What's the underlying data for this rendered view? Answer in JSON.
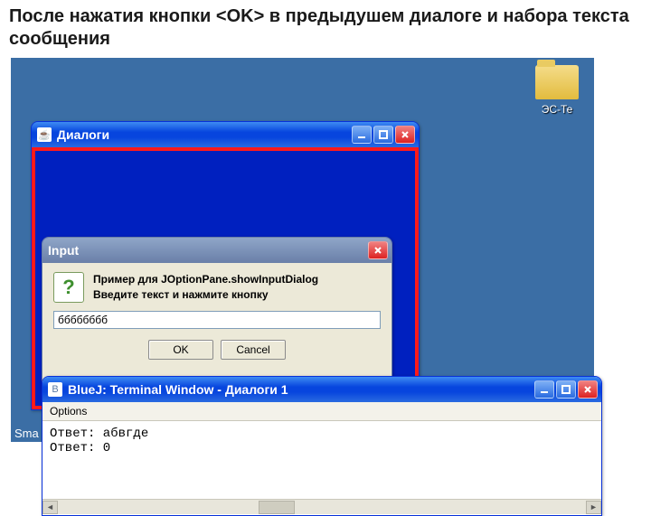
{
  "caption_pre": "После нажатия кнопки ",
  "caption_mid": "<OK>",
  "caption_post": " в предыдушем диалоге и набора текста сообщения",
  "desktop": {
    "folder_label_right": "ЭС-Те",
    "taskbar_snippet": "Sma"
  },
  "dialogs_window": {
    "title": "Диалоги"
  },
  "input_dialog": {
    "title": "Input",
    "message_line1": "Пример для JOptionPane.showInputDialog",
    "message_line2": "Введите текст и нажмите кнопку",
    "field_value": "бббббббб",
    "ok_label": "OK",
    "cancel_label": "Cancel"
  },
  "terminal": {
    "title": "BlueJ:  Terminal Window - Диалоги 1",
    "menu_options": "Options",
    "line1": "Ответ: абвгде",
    "line2": "Ответ: 0"
  }
}
